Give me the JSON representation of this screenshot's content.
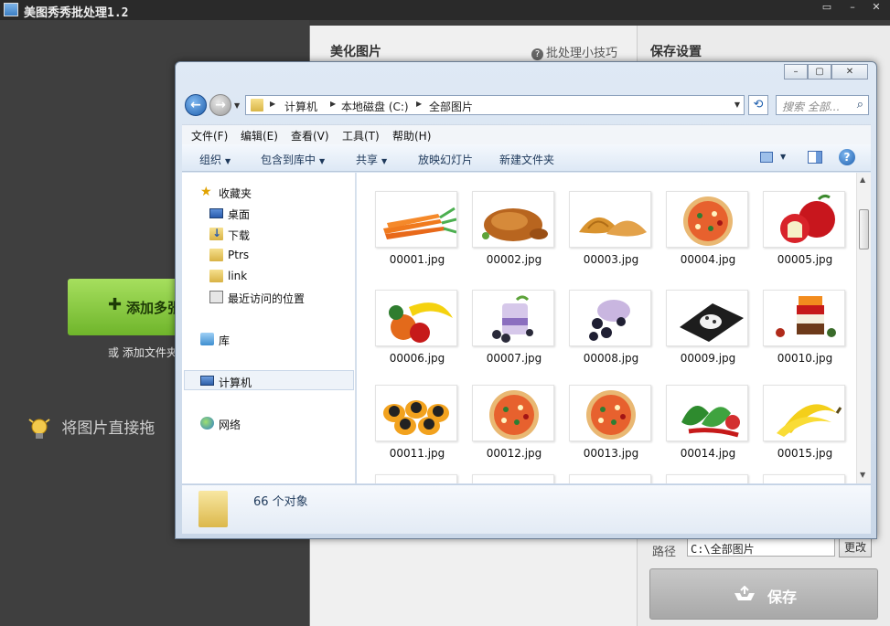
{
  "app": {
    "title": "美图秀秀批处理1.2",
    "add_button": "添加多张",
    "or_add_folder": "或  添加文件夹",
    "drag_hint": "将图片直接拖"
  },
  "mid": {
    "title": "美化图片",
    "tips": "批处理小技巧"
  },
  "right": {
    "title": "保存设置",
    "path_label": "路径",
    "path_value": "C:\\全部图片",
    "change_button": "更改",
    "save_button": "保存"
  },
  "explorer": {
    "address": [
      "计算机",
      "本地磁盘 (C:)",
      "全部图片"
    ],
    "search_placeholder": "搜索 全部...",
    "menu": [
      "文件(F)",
      "编辑(E)",
      "查看(V)",
      "工具(T)",
      "帮助(H)"
    ],
    "toolbar": {
      "organize": "组织",
      "include_library": "包含到库中",
      "share": "共享",
      "slideshow": "放映幻灯片",
      "new_folder": "新建文件夹"
    },
    "nav": {
      "favorites": "收藏夹",
      "desktop": "桌面",
      "downloads": "下载",
      "ptrs": "Ptrs",
      "link": "link",
      "recent": "最近访问的位置",
      "libraries": "库",
      "computer": "计算机",
      "network": "网络"
    },
    "files": [
      {
        "name": "00001.jpg",
        "subject": "carrots"
      },
      {
        "name": "00002.jpg",
        "subject": "roast-chicken"
      },
      {
        "name": "00003.jpg",
        "subject": "croissants"
      },
      {
        "name": "00004.jpg",
        "subject": "pizza"
      },
      {
        "name": "00005.jpg",
        "subject": "apples"
      },
      {
        "name": "00006.jpg",
        "subject": "fruit-bananas"
      },
      {
        "name": "00007.jpg",
        "subject": "berry-dessert"
      },
      {
        "name": "00008.jpg",
        "subject": "blackberries"
      },
      {
        "name": "00009.jpg",
        "subject": "sushi-plate"
      },
      {
        "name": "00010.jpg",
        "subject": "spices"
      },
      {
        "name": "00011.jpg",
        "subject": "caviar-eggs"
      },
      {
        "name": "00012.jpg",
        "subject": "pizza"
      },
      {
        "name": "00013.jpg",
        "subject": "pizza"
      },
      {
        "name": "00014.jpg",
        "subject": "peppers"
      },
      {
        "name": "00015.jpg",
        "subject": "bananas"
      }
    ],
    "status": "66 个对象"
  }
}
